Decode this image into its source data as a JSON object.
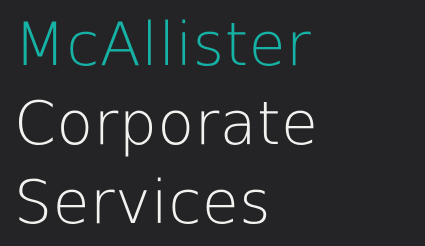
{
  "heading": {
    "line1": "McAllister",
    "line2": "Corporate",
    "line3": "Services"
  },
  "colors": {
    "background": "#242426",
    "accent": "#16b2a6",
    "text": "#f2f2f0"
  }
}
